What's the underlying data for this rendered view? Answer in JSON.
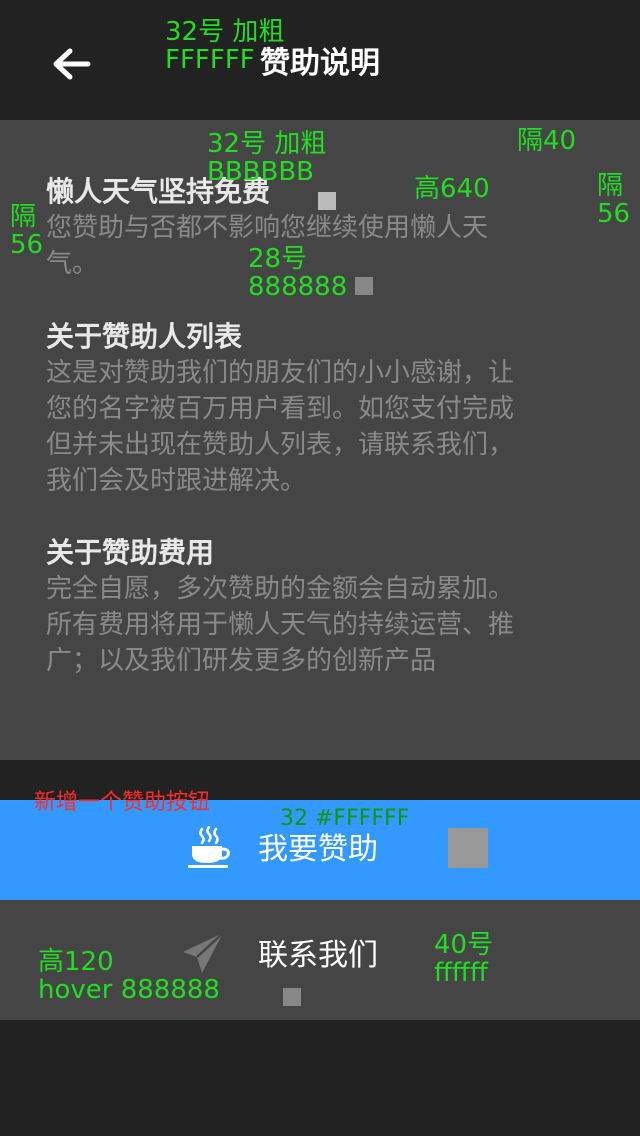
{
  "header": {
    "title": "赞助说明"
  },
  "sections": [
    {
      "title": "懒人天气坚持免费",
      "body_lines": [
        "您赞助与否都不影响您继续使用懒人天",
        "气。"
      ]
    },
    {
      "title": "关于赞助人列表",
      "body_lines": [
        "这是对赞助我们的朋友们的小小感谢，让",
        "您的名字被百万用户看到。如您支付完成",
        "但并未出现在赞助人列表，请联系我们，",
        "我们会及时跟进解决。"
      ]
    },
    {
      "title": "关于赞助费用",
      "body_lines": [
        "完全自愿，多次赞助的金额会自动累加。",
        "所有费用将用于懒人天气的持续运营、推",
        "广；以及我们研发更多的创新产品"
      ]
    }
  ],
  "buttons": {
    "sponsor_label": "我要赞助",
    "contact_label": "联系我们"
  },
  "icons": {
    "back": "arrow-left-icon",
    "sponsor": "coffee-cup-icon",
    "contact": "paper-plane-icon"
  },
  "colors": {
    "background": "#222222",
    "panel": "#454545",
    "sponsor_button": "#3399FF",
    "title_text": "#FFFFFF",
    "section_title": "#BBBBBB",
    "section_body": "#888888"
  },
  "annotations": {
    "title_size": "32号  加粗",
    "title_color": "FFFFFF",
    "section_title_size": "32号  加粗",
    "section_title_color": "BBBBBB",
    "gap_40": "隔40",
    "height_640": "高640",
    "gap_56_right_a": "隔",
    "gap_56_right_b": "56",
    "gap_56_left_a": "隔",
    "gap_56_left_b": "56",
    "body_size": "28号",
    "body_color": "888888",
    "new_button_note": "新增一个赞助按钮",
    "sponsor_spec": "32  #FFFFFF",
    "height_120": "高120",
    "hover_color": "hover 888888",
    "contact_size": "40号",
    "contact_color": "ffffff"
  }
}
